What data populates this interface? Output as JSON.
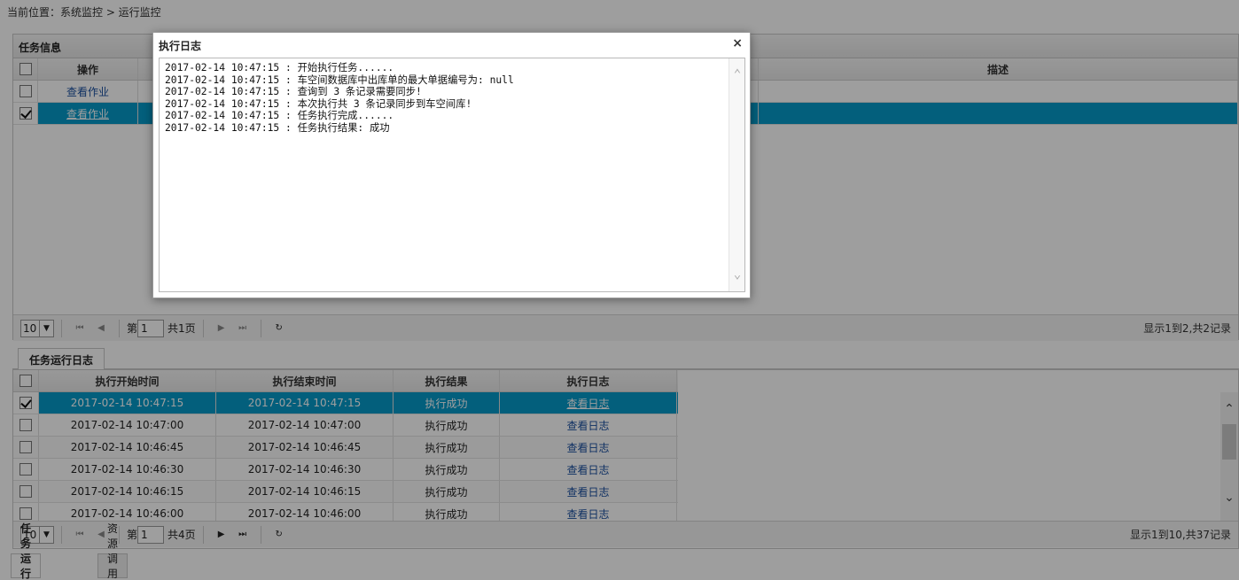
{
  "breadcrumb": "当前位置：系统监控 > 运行监控",
  "task_panel": {
    "title": "任务信息",
    "columns": {
      "action": "操作",
      "description": "描述"
    },
    "rows": [
      {
        "action": "查看作业",
        "checked": false
      },
      {
        "action": "查看作业",
        "checked": true
      }
    ],
    "pager": {
      "page_size": "10",
      "page_label": "第",
      "page_value": "1",
      "total_pages": "共1页",
      "info": "显示1到2,共2记录"
    }
  },
  "log_panel": {
    "tab": "任务运行日志",
    "columns": {
      "start": "执行开始时间",
      "end": "执行结束时间",
      "result": "执行结果",
      "log": "执行日志"
    },
    "rows": [
      {
        "start": "2017-02-14 10:47:15",
        "end": "2017-02-14 10:47:15",
        "result": "执行成功",
        "log": "查看日志",
        "checked": true
      },
      {
        "start": "2017-02-14 10:47:00",
        "end": "2017-02-14 10:47:00",
        "result": "执行成功",
        "log": "查看日志",
        "checked": false
      },
      {
        "start": "2017-02-14 10:46:45",
        "end": "2017-02-14 10:46:45",
        "result": "执行成功",
        "log": "查看日志",
        "checked": false
      },
      {
        "start": "2017-02-14 10:46:30",
        "end": "2017-02-14 10:46:30",
        "result": "执行成功",
        "log": "查看日志",
        "checked": false
      },
      {
        "start": "2017-02-14 10:46:15",
        "end": "2017-02-14 10:46:15",
        "result": "执行成功",
        "log": "查看日志",
        "checked": false
      },
      {
        "start": "2017-02-14 10:46:00",
        "end": "2017-02-14 10:46:00",
        "result": "执行成功",
        "log": "查看日志",
        "checked": false
      }
    ],
    "pager": {
      "page_size": "10",
      "page_label": "第",
      "page_value": "1",
      "total_pages": "共4页",
      "info": "显示1到10,共37记录"
    }
  },
  "bottom_tabs": [
    "任务运行日志",
    "资源调用日志"
  ],
  "dialog": {
    "title": "执行日志",
    "close": "×",
    "lines": [
      "2017-02-14 10:47:15 : 开始执行任务......",
      "2017-02-14 10:47:15 : 车空间数据库中出库单的最大单据编号为: null",
      "2017-02-14 10:47:15 : 查询到 3 条记录需要同步!",
      "2017-02-14 10:47:15 : 本次执行共 3 条记录同步到车空间库!",
      "2017-02-14 10:47:15 : 任务执行完成......",
      "2017-02-14 10:47:15 : 任务执行结果: 成功"
    ]
  },
  "colors": {
    "selected_row": "#0599c9",
    "link": "#1a4fa0",
    "overlay": "rgba(0,0,0,0.38)"
  }
}
